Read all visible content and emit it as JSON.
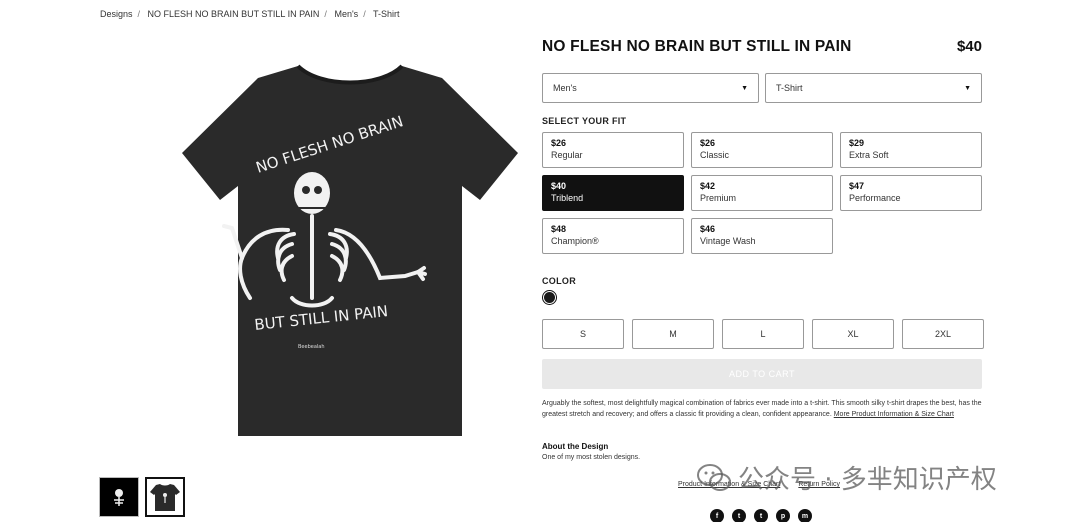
{
  "breadcrumb": [
    "Designs",
    "NO FLESH NO BRAIN BUT STILL IN PAIN",
    "Men's",
    "T-Shirt"
  ],
  "product": {
    "title": "NO FLESH NO BRAIN BUT STILL IN PAIN",
    "price": "$40",
    "shirt_color": "#2a2a2a"
  },
  "design_text": {
    "top": "NO FLESH   NO BRAIN",
    "bottom": "BUT STILL IN PAIN",
    "signature": "Beebealah"
  },
  "selects": {
    "gender": "Men's",
    "style": "T-Shirt"
  },
  "fit": {
    "label": "SELECT YOUR FIT",
    "options": [
      {
        "price": "$26",
        "name": "Regular"
      },
      {
        "price": "$26",
        "name": "Classic"
      },
      {
        "price": "$29",
        "name": "Extra Soft"
      },
      {
        "price": "$40",
        "name": "Triblend"
      },
      {
        "price": "$42",
        "name": "Premium"
      },
      {
        "price": "$47",
        "name": "Performance"
      },
      {
        "price": "$48",
        "name": "Champion®"
      },
      {
        "price": "$46",
        "name": "Vintage Wash"
      }
    ],
    "selected": "Triblend"
  },
  "color": {
    "label": "COLOR",
    "swatch": "#1a1a1a"
  },
  "sizes": [
    "S",
    "M",
    "L",
    "XL",
    "2XL"
  ],
  "cart": {
    "label": "ADD TO CART"
  },
  "description": {
    "text": "Arguably the softest, most delightfully magical combination of fabrics ever made into a t-shirt. This smooth silky t-shirt drapes the best, has the greatest stretch and recovery; and offers a classic fit providing a clean, confident appearance.",
    "link": "More Product Information & Size Chart"
  },
  "about": {
    "title": "About the Design",
    "text": "One of my most stolen designs."
  },
  "links": {
    "info": "Product Information & Size Chart",
    "return": "Return Policy"
  },
  "social": [
    "f",
    "t",
    "t",
    "p",
    "m"
  ],
  "watermark": "公众号 · 多芈知识产权"
}
